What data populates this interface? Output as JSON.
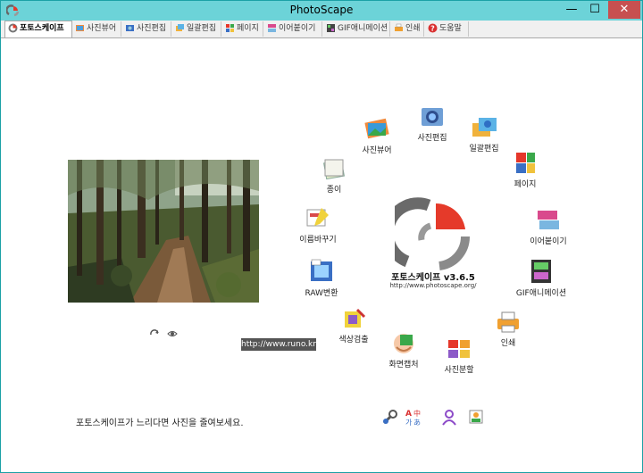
{
  "window": {
    "title": "PhotoScape",
    "minimize_glyph": "—",
    "maximize_glyph": "☐",
    "close_glyph": "✕"
  },
  "tabs": [
    {
      "label": "포토스케이프",
      "icon": "photoscape-logo-icon",
      "active": true
    },
    {
      "label": "사진뷰어",
      "icon": "viewer-icon"
    },
    {
      "label": "사진편집",
      "icon": "editor-icon"
    },
    {
      "label": "일괄편집",
      "icon": "batch-icon"
    },
    {
      "label": "페이지",
      "icon": "page-icon"
    },
    {
      "label": "이어붙이기",
      "icon": "combine-icon"
    },
    {
      "label": "GIF애니메이션",
      "icon": "gif-icon"
    },
    {
      "label": "인쇄",
      "icon": "print-icon"
    },
    {
      "label": "도움말",
      "icon": "help-icon"
    }
  ],
  "home": {
    "link_text": "http://www.runo.kr",
    "hint_text": "포토스케이프가 느리다면 사진을 줄여보세요.",
    "brand_name": "포토스케이프 v3.6.5",
    "brand_url": "http://www.photoscape.org/",
    "menu": [
      {
        "label": "사진뷰어",
        "icon": "viewer-icon"
      },
      {
        "label": "사진편집",
        "icon": "editor-icon"
      },
      {
        "label": "일괄편집",
        "icon": "batch-icon"
      },
      {
        "label": "페이지",
        "icon": "page-icon"
      },
      {
        "label": "이어붙이기",
        "icon": "combine-icon"
      },
      {
        "label": "GIF애니메이션",
        "icon": "gif-icon"
      },
      {
        "label": "인쇄",
        "icon": "print-icon"
      },
      {
        "label": "사진분할",
        "icon": "splitter-icon"
      },
      {
        "label": "화면캡처",
        "icon": "screen-capture-icon"
      },
      {
        "label": "색상검출",
        "icon": "color-picker-icon"
      },
      {
        "label": "RAW변환",
        "icon": "raw-converter-icon"
      },
      {
        "label": "이름바꾸기",
        "icon": "rename-icon"
      },
      {
        "label": "종이",
        "icon": "paper-icon"
      }
    ]
  },
  "colors": {
    "titlebar": "#6cd3d8",
    "close_button": "#c75050",
    "logo_red": "#e53a2a",
    "logo_gray": "#8a8a8a"
  }
}
